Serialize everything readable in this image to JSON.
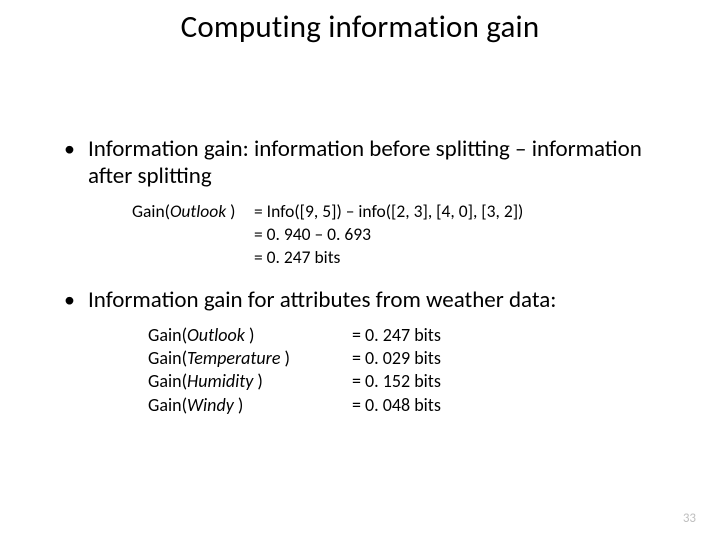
{
  "title": "Computing information gain",
  "bullet1": "Information gain: information before splitting – information after splitting",
  "calc": {
    "lhs_prefix": "Gain(",
    "lhs_attr": "Outlook",
    "lhs_suffix": " )",
    "rhs1": "= Info([9, 5]) – info([2, 3], [4, 0], [3, 2])",
    "rhs2": "= 0. 940 – 0. 693",
    "rhs3": "= 0. 247 bits"
  },
  "bullet2": "Information gain for attributes from weather data:",
  "gains": {
    "prefix": "Gain(",
    "suffix": " )",
    "rows": [
      {
        "attr": "Outlook",
        "value": "= 0. 247 bits"
      },
      {
        "attr": "Temperature",
        "value": "= 0. 029 bits"
      },
      {
        "attr": "Humidity",
        "value": "= 0. 152 bits"
      },
      {
        "attr": "Windy",
        "value": "= 0. 048 bits"
      }
    ]
  },
  "page_number": "33"
}
